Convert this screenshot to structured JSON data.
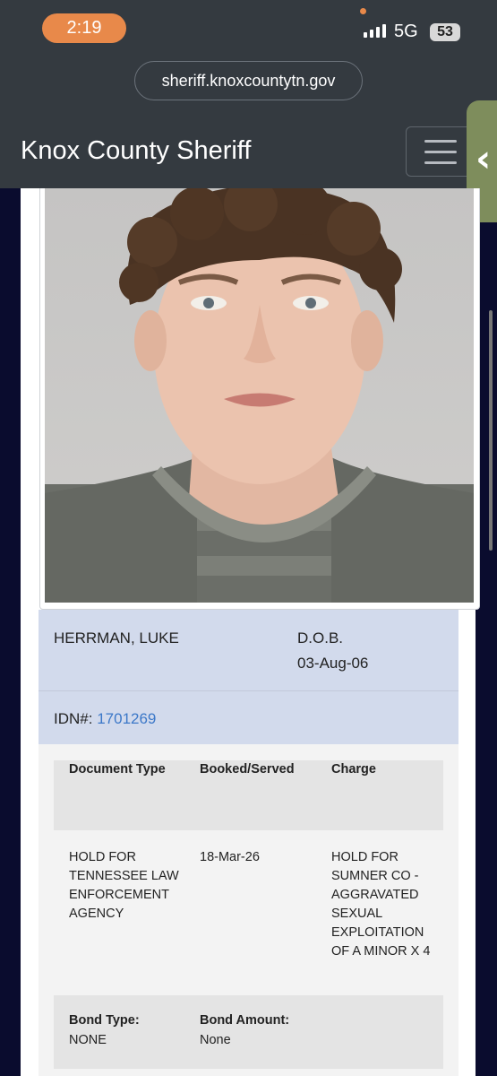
{
  "status_bar": {
    "time": "2:19",
    "network": "5G",
    "battery": "53"
  },
  "browser": {
    "url": "sheriff.knoxcountytn.gov"
  },
  "header": {
    "site_title": "Knox County Sheriff"
  },
  "inmate": {
    "name": "HERRMAN, LUKE",
    "dob_label": "D.O.B.",
    "dob": "03-Aug-06",
    "idn_label": "IDN#:",
    "idn": "1701269"
  },
  "table": {
    "headers": [
      "Document Type",
      "Booked/Served",
      "Charge"
    ],
    "rows": [
      [
        "HOLD FOR TENNESSEE LAW ENFORCEMENT AGENCY",
        "18-Mar-26",
        "HOLD FOR SUMNER CO - AGGRAVATED SEXUAL EXPLOITATION OF A MINOR X 4"
      ]
    ]
  },
  "bond": {
    "type_label": "Bond Type:",
    "type": "NONE",
    "amount_label": "Bond Amount:",
    "amount": "None"
  },
  "colors": {
    "chrome": "#343a40",
    "time_pill": "#e8894a",
    "info_block": "#d2daec",
    "link": "#3c78c8",
    "page_bg": "#0a0c2e"
  }
}
